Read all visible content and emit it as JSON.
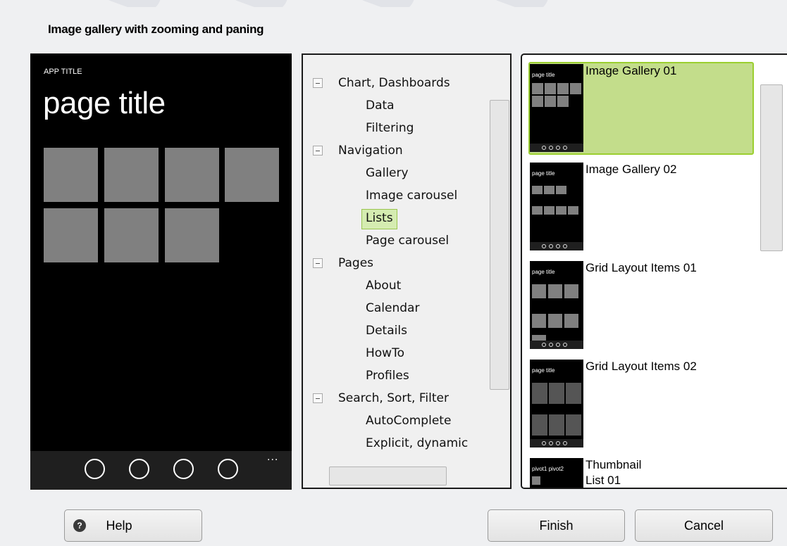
{
  "dialog": {
    "title": "Image gallery with zooming and paning"
  },
  "preview": {
    "app_title": "APP TITLE",
    "page_title": "page title",
    "more_glyph": "..."
  },
  "tree": {
    "items": [
      {
        "label": "Chart, Dashboards",
        "level": 0
      },
      {
        "label": "Data",
        "level": 1
      },
      {
        "label": "Filtering",
        "level": 1
      },
      {
        "label": "Navigation",
        "level": 0
      },
      {
        "label": "Gallery",
        "level": 1
      },
      {
        "label": "Image carousel",
        "level": 1
      },
      {
        "label": "Lists",
        "level": 1,
        "selected": true
      },
      {
        "label": "Page carousel",
        "level": 1
      },
      {
        "label": "Pages",
        "level": 0
      },
      {
        "label": "About",
        "level": 1
      },
      {
        "label": "Calendar",
        "level": 1
      },
      {
        "label": "Details",
        "level": 1
      },
      {
        "label": "HowTo",
        "level": 1
      },
      {
        "label": "Profiles",
        "level": 1
      },
      {
        "label": "Search, Sort, Filter",
        "level": 0
      },
      {
        "label": "AutoComplete",
        "level": 1
      },
      {
        "label": "Explicit, dynamic",
        "level": 1
      }
    ]
  },
  "templates": {
    "items": [
      {
        "label": "Image Gallery 01",
        "selected": true,
        "thumb_title": "page title"
      },
      {
        "label": "Image Gallery 02",
        "thumb_title": "page title"
      },
      {
        "label": "Grid Layout Items 01",
        "thumb_title": "page title"
      },
      {
        "label": "Grid Layout Items 02",
        "thumb_title": "page title"
      },
      {
        "label": "Thumbnail\nList 01",
        "thumb_title": "pivot1 pivot2"
      }
    ]
  },
  "buttons": {
    "help": "Help",
    "finish": "Finish",
    "cancel": "Cancel",
    "help_icon_glyph": "?"
  },
  "colors": {
    "selection_fill": "#c3dd8b",
    "selection_border": "#9bcf2f",
    "tile": "#808080",
    "phone_bg": "#000000"
  }
}
